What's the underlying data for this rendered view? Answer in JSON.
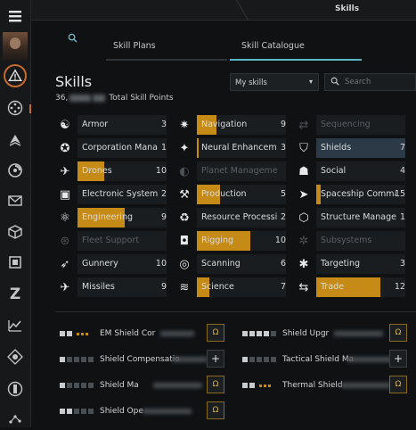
{
  "window": {
    "title": "Skills"
  },
  "sidebar": {
    "items": [
      {
        "icon": "hamburger-menu-icon"
      },
      {
        "icon": "character-portrait"
      },
      {
        "icon": "warning-icon"
      },
      {
        "icon": "network-icon"
      },
      {
        "icon": "fleet-icon"
      },
      {
        "icon": "agency-icon"
      },
      {
        "icon": "mail-icon"
      },
      {
        "icon": "inventory-cube-icon"
      },
      {
        "icon": "datacube-icon"
      },
      {
        "icon": "z-icon"
      },
      {
        "icon": "market-chart-icon"
      },
      {
        "icon": "industry-icon"
      },
      {
        "icon": "structure-icon"
      },
      {
        "icon": "map-icon"
      }
    ]
  },
  "tabs": [
    {
      "label": "Skill Plans",
      "active": false
    },
    {
      "label": "Skill Catalogue",
      "active": true
    }
  ],
  "header": {
    "title": "Skills",
    "skill_points_prefix": "36,",
    "skill_points_suffix": "Total Skill Points"
  },
  "filter": {
    "selected": "My skills"
  },
  "search": {
    "placeholder": "Search"
  },
  "colors": {
    "accent": "#c68a16",
    "tab_underline": "#5ab4c8",
    "selected_row": "#2b3a46"
  },
  "skill_groups": [
    {
      "name": "Armor",
      "level": "3",
      "icon": "armor-icon",
      "progress": 0.0
    },
    {
      "name": "Navigation",
      "level": "9",
      "icon": "navigation-icon",
      "progress": 0.22
    },
    {
      "name": "Sequencing",
      "level": "",
      "icon": "sequencing-icon",
      "progress": 0.0,
      "disabled": true
    },
    {
      "name": "Corporation Manag",
      "level": "1",
      "icon": "corporation-icon",
      "progress": 0.0
    },
    {
      "name": "Neural Enhanceme",
      "level": "3",
      "icon": "neural-icon",
      "progress": 0.02
    },
    {
      "name": "Shields",
      "level": "7",
      "icon": "shield-icon",
      "progress": 0.0,
      "selected": true
    },
    {
      "name": "Drones",
      "level": "10",
      "icon": "drone-icon",
      "progress": 0.3
    },
    {
      "name": "Planet Managemer",
      "level": "",
      "icon": "planet-icon",
      "progress": 0.0,
      "disabled": true
    },
    {
      "name": "Social",
      "level": "4",
      "icon": "social-icon",
      "progress": 0.0
    },
    {
      "name": "Electronic System",
      "level": "2",
      "icon": "electronics-icon",
      "progress": 0.0
    },
    {
      "name": "Production",
      "level": "5",
      "icon": "production-icon",
      "progress": 0.26
    },
    {
      "name": "Spaceship Comma",
      "level": "15",
      "icon": "spaceship-icon",
      "progress": 0.05
    },
    {
      "name": "Engineering",
      "level": "9",
      "icon": "engineering-icon",
      "progress": 0.53
    },
    {
      "name": "Resource Processi",
      "level": "2",
      "icon": "recycle-icon",
      "progress": 0.0
    },
    {
      "name": "Structure Managem",
      "level": "1",
      "icon": "structure-management-icon",
      "progress": 0.0
    },
    {
      "name": "Fleet Support",
      "level": "",
      "icon": "fleet-support-icon",
      "progress": 0.0,
      "disabled": true
    },
    {
      "name": "Rigging",
      "level": "10",
      "icon": "rigging-icon",
      "progress": 0.6
    },
    {
      "name": "Subsystems",
      "level": "",
      "icon": "subsystems-icon",
      "progress": 0.0,
      "disabled": true
    },
    {
      "name": "Gunnery",
      "level": "10",
      "icon": "gunnery-icon",
      "progress": 0.0
    },
    {
      "name": "Scanning",
      "level": "6",
      "icon": "scanning-icon",
      "progress": 0.0
    },
    {
      "name": "Targeting",
      "level": "3",
      "icon": "targeting-icon",
      "progress": 0.0
    },
    {
      "name": "Missiles",
      "level": "9",
      "icon": "missile-icon",
      "progress": 0.0
    },
    {
      "name": "Science",
      "level": "7",
      "icon": "science-icon",
      "progress": 0.14
    },
    {
      "name": "Trade",
      "level": "12",
      "icon": "trade-icon",
      "progress": 0.72
    }
  ],
  "queue": [
    {
      "name": "EM Shield Cor",
      "trained": 2,
      "queued": 3,
      "action": "omega-icon"
    },
    {
      "name": "Shield Upgr",
      "trained": 4,
      "queued": 0,
      "action": "omega-icon"
    },
    {
      "name": "Shield Compensatio",
      "trained": 1,
      "queued": 0,
      "action": "plus-icon"
    },
    {
      "name": "Tactical Shield Ma",
      "trained": 1,
      "queued": 0,
      "action": "plus-icon"
    },
    {
      "name": "Shield Ma",
      "trained": 1,
      "queued": 0,
      "action": "omega-icon"
    },
    {
      "name": "Thermal Shield",
      "trained": 2,
      "queued": 3,
      "action": "omega-icon"
    },
    {
      "name": "Shield Ope",
      "trained": 2,
      "queued": 0,
      "action": "omega-icon"
    }
  ]
}
